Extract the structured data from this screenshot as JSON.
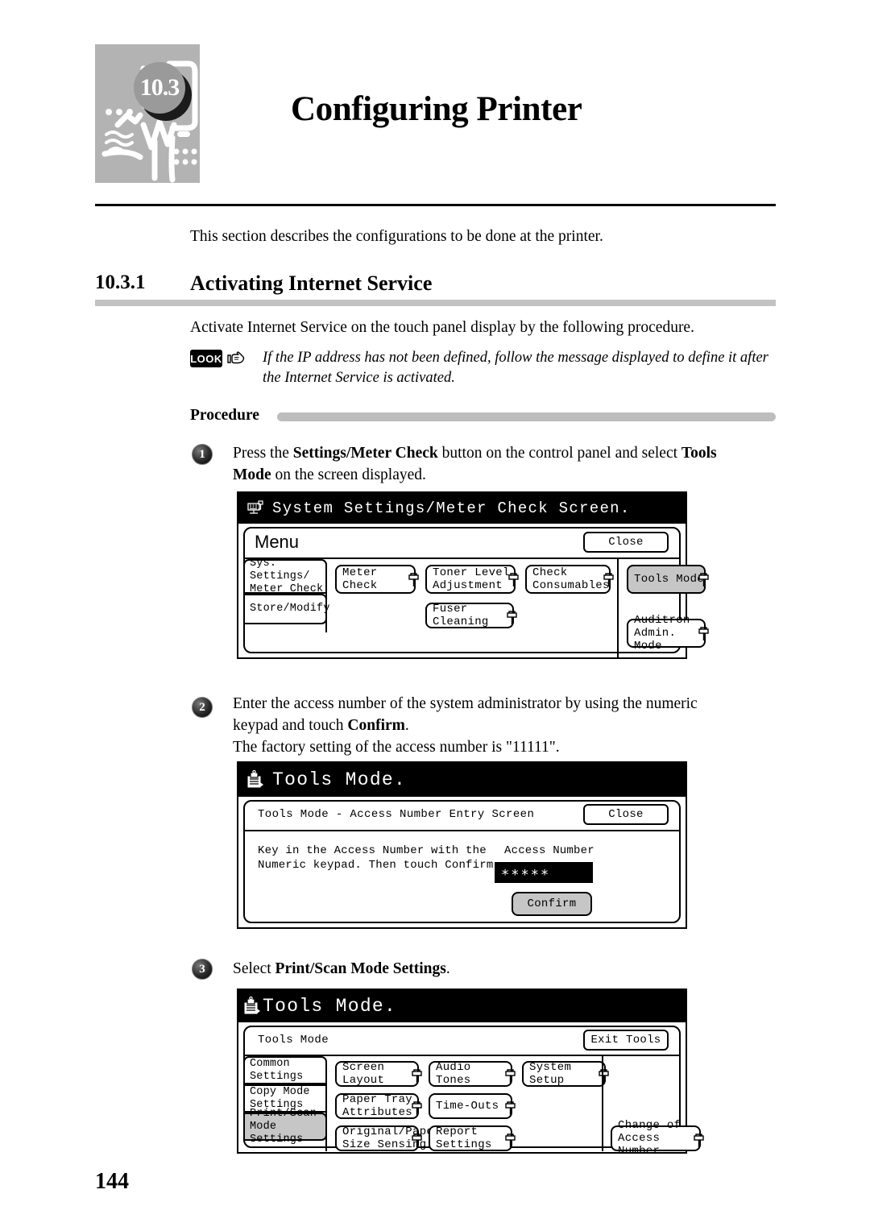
{
  "chapter": {
    "number": "10.3",
    "title": "Configuring Printer",
    "art_icon": "printer-illustration"
  },
  "intro": "This section describes the configurations to be done at the printer.",
  "section": {
    "number": "10.3.1",
    "title": "Activating Internet Service"
  },
  "activate_line": "Activate Internet Service on the touch panel display by the following procedure.",
  "note": {
    "badge": "LOOK",
    "hand_icon": "pointing-hand-icon",
    "text": "If the IP address has not been defined, follow the message displayed to define it after the Internet Service is activated."
  },
  "procedure": {
    "label": "Procedure"
  },
  "steps": [
    {
      "number": "1",
      "line1_a": "Press the ",
      "line1_b": "Settings/Meter Check",
      "line1_c": " button on the control panel and select ",
      "line1_d": "Tools",
      "line2_a": "Mode",
      "line2_b": " on the screen displayed."
    },
    {
      "number": "2",
      "line1_a": "Enter the access number of the system administrator by using the numeric",
      "line2_a": "keypad and touch ",
      "line2_b": "Confirm",
      "line2_c": ".",
      "line3": "The factory setting of the access number is \"11111\"."
    },
    {
      "number": "3",
      "line1_a": "Select ",
      "line1_b": "Print/Scan Mode Settings",
      "line1_c": "."
    }
  ],
  "panel1": {
    "title": "System Settings/Meter Check Screen.",
    "title_icon": "control-panel-icon",
    "menu_label": "Menu",
    "close_button": "Close",
    "tabs": [
      {
        "label": "Sys. Settings/\nMeter Check",
        "selected": false
      },
      {
        "label": "Store/Modify",
        "selected": false
      }
    ],
    "buttons": [
      {
        "label": "Meter Check",
        "selected": false,
        "icon": "page-corner-icon"
      },
      {
        "label": "Toner Level\nAdjustment",
        "selected": false,
        "icon": "page-corner-icon"
      },
      {
        "label": "Check\nConsumables",
        "selected": false,
        "icon": "page-corner-icon"
      },
      {
        "label": "Tools Mode",
        "selected": true,
        "icon": "page-corner-icon"
      },
      {
        "label": "Fuser Cleaning",
        "selected": false,
        "icon": "page-corner-icon"
      },
      {
        "label": "Auditron\nAdmin. Mode",
        "selected": false,
        "icon": "page-corner-icon"
      }
    ]
  },
  "panel2": {
    "title": "Tools Mode.",
    "title_icon": "tools-documents-icon",
    "screen_label": "Tools Mode - Access Number Entry Screen",
    "close_button": "Close",
    "instruction": "Key in the Access Number with the\nNumeric keypad. Then touch Confirm.",
    "field_label": "Access Number",
    "field_value": "∗∗∗∗∗",
    "confirm_button": "Confirm"
  },
  "panel3": {
    "title": "Tools Mode.",
    "title_icon": "tools-documents-icon",
    "screen_label": "Tools Mode",
    "exit_button": "Exit Tools",
    "tabs": [
      {
        "label": "Common\nSettings",
        "selected": false
      },
      {
        "label": "Copy Mode\nSettings",
        "selected": false
      },
      {
        "label": "Print/Scan\nMode Settings",
        "selected": true
      }
    ],
    "buttons": [
      {
        "label": "Screen Layout",
        "icon": "page-corner-icon"
      },
      {
        "label": "Audio Tones",
        "icon": "page-corner-icon"
      },
      {
        "label": "System Setup",
        "icon": "page-corner-icon"
      },
      {
        "label": "Paper Tray\nAttributes",
        "icon": "page-corner-icon"
      },
      {
        "label": "Time-Outs",
        "icon": "page-corner-icon"
      },
      {
        "label": "Original/Paper\nSize Sensing",
        "icon": "page-corner-icon"
      },
      {
        "label": "Report\nSettings",
        "icon": "page-corner-icon"
      },
      {
        "label": "Change of\nAccess Number",
        "icon": "page-corner-icon"
      }
    ]
  },
  "page_number": "144",
  "colors": {
    "accent_gray": "#c2c2c2",
    "selected_button": "#c6c6c6",
    "art_background": "#b3b3b3"
  }
}
